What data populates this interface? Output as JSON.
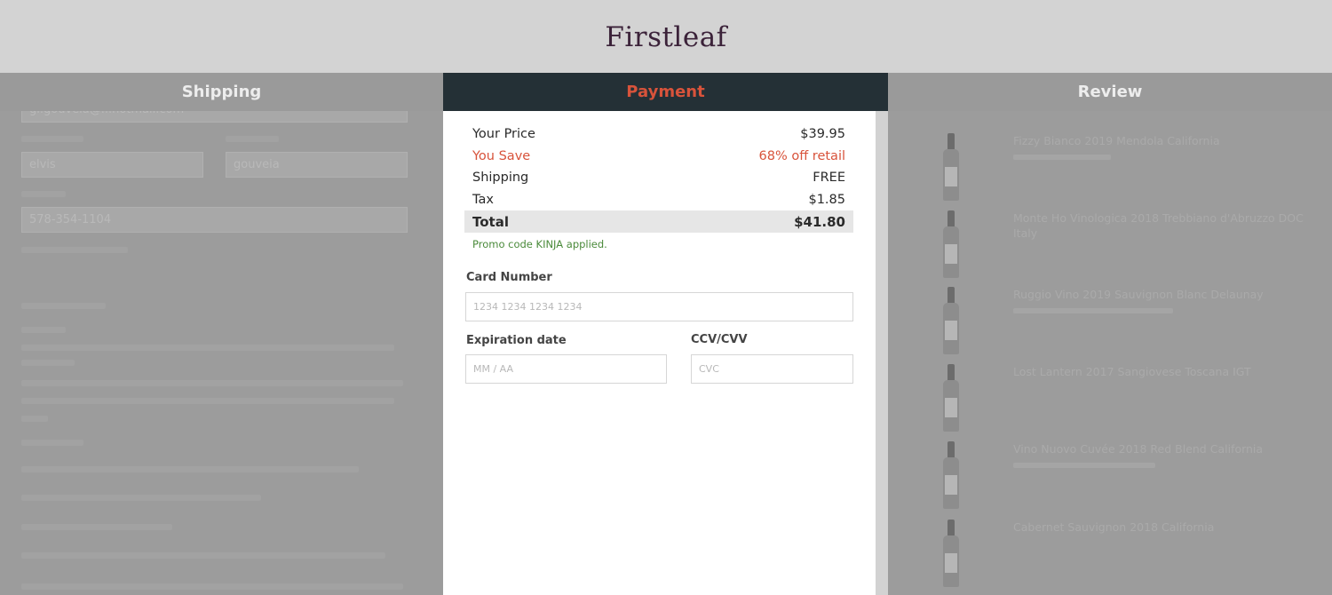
{
  "brand": {
    "logo_text": "Firstleaf"
  },
  "tabs": {
    "shipping": "Shipping",
    "payment": "Payment",
    "review": "Review"
  },
  "shipping_form": {
    "email_value": "gi.gouveia@...hotmail.com",
    "first_name_value": "elvis",
    "last_name_value": "gouveia",
    "phone_value": "578-354-1104"
  },
  "summary": {
    "your_price_label": "Your Price",
    "your_price_value": "$39.95",
    "you_save_label": "You Save",
    "you_save_value": "68% off retail",
    "shipping_label": "Shipping",
    "shipping_value": "FREE",
    "tax_label": "Tax",
    "tax_value": "$1.85",
    "total_label": "Total",
    "total_value": "$41.80",
    "promo_text": "Promo code KINJA applied."
  },
  "card": {
    "number_label": "Card Number",
    "number_placeholder": "1234 1234 1234 1234",
    "expiry_label": "Expiration date",
    "expiry_placeholder": "MM / AA",
    "cvc_label": "CCV/CVV",
    "cvc_placeholder": "CVC"
  },
  "review_products": [
    {
      "name": "Fizzy Bianco 2019 Mendola California"
    },
    {
      "name": "Monte Ho Vinologica 2018 Trebbiano d'Abruzzo DOC Italy"
    },
    {
      "name": "Ruggio Vino 2019 Sauvignon Blanc Delaunay"
    },
    {
      "name": "Lost Lantern 2017 Sangiovese Toscana IGT"
    },
    {
      "name": "Vino Nuovo Cuvée 2018 Red Blend California"
    },
    {
      "name": "Cabernet Sauvignon 2018 California"
    }
  ]
}
